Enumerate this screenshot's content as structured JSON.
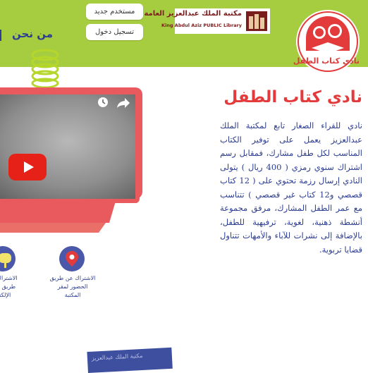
{
  "header": {
    "about_label": "من نحن",
    "new_user_label": "مستخدم جديد",
    "login_label": "تسجيل دخول",
    "library_name_ar": "مكتبة الملك عبدالعزيز العامة",
    "library_name_en": "King Abdul Aziz PUBLIC Library",
    "club_logo_text": "نادي كتاب الطفل"
  },
  "main": {
    "title": "نادي كتاب الطفل",
    "description": "نادي للقراء الصغار تابع لمكتبة الملك عبدالعزيز يعمل على توفير الكتاب المناسب لكل طفل مشارك، فمقابل رسم اشتراك سنوي رمزي ( 400 ريال ) يتولى النادي إرسال رزمة تحتوي على ( 12 كتاب قصصي و12 كتاب غير قصصي ) تتناسب مع عمر الطفل المشارك، مرفق مجموعة أنشطة ذهنية، لغوية، ترفيهية للطفل، بالإضافة إلى نشرات للآباء والأمهات تتناول قضايا تربوية."
  },
  "subscription_options": [
    {
      "label": "الاشتراك عن طريق الحضور لمقر المكتبة",
      "icon": "location-pin-icon"
    },
    {
      "label": "الاشتراك عن طريق البريد الإلكتروني",
      "icon": "mailbox-icon"
    }
  ],
  "footer": {
    "book_label": "مكتبة الملك عبدالعزيز"
  },
  "colors": {
    "header_green": "#a6cc3f",
    "brand_red": "#e33b3b",
    "text_blue": "#2c3d92",
    "icon_blue": "#4b57a8",
    "youtube_red": "#e62117"
  }
}
